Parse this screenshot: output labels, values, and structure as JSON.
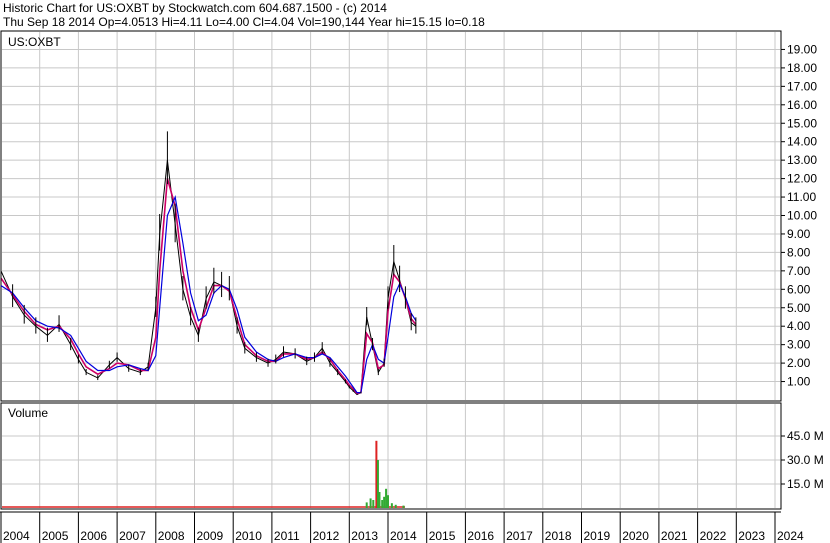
{
  "header": {
    "line1": "Historic Chart for US:OXBT by Stockwatch.com 604.687.1500 - (c) 2014",
    "line2": "Thu Sep 18 2014  Op=4.0513  Hi=4.11  Lo=4.00  Cl=4.04  Vol=190,144  Year hi=15.15  lo=0.18"
  },
  "chart_data": [
    {
      "type": "line",
      "title": "US:OXBT",
      "xlabel": "",
      "ylabel": "",
      "ylim": [
        0,
        20
      ],
      "x_ticks": [
        "2004",
        "2005",
        "2006",
        "2007",
        "2008",
        "2009",
        "2010",
        "2011",
        "2012",
        "2013",
        "2014",
        "2015",
        "2016",
        "2017",
        "2018",
        "2019",
        "2020",
        "2021",
        "2022",
        "2023",
        "2024"
      ],
      "y_ticks": [
        "19.00",
        "18.00",
        "17.00",
        "16.00",
        "15.00",
        "14.00",
        "13.00",
        "12.00",
        "11.00",
        "10.00",
        "9.00",
        "8.00",
        "7.00",
        "6.00",
        "5.00",
        "4.00",
        "3.00",
        "2.00",
        "1.00"
      ],
      "grid": true,
      "x": [
        2004.0,
        2004.3,
        2004.6,
        2004.9,
        2005.2,
        2005.5,
        2005.8,
        2006.0,
        2006.2,
        2006.5,
        2006.8,
        2007.0,
        2007.3,
        2007.6,
        2007.8,
        2008.0,
        2008.1,
        2008.3,
        2008.5,
        2008.7,
        2008.9,
        2009.1,
        2009.3,
        2009.5,
        2009.7,
        2009.9,
        2010.1,
        2010.3,
        2010.6,
        2010.9,
        2011.1,
        2011.3,
        2011.6,
        2011.9,
        2012.1,
        2012.3,
        2012.5,
        2012.7,
        2012.9,
        2013.0,
        2013.1,
        2013.2,
        2013.3,
        2013.45,
        2013.6,
        2013.75,
        2013.9,
        2014.0,
        2014.15,
        2014.3,
        2014.45,
        2014.6,
        2014.72
      ],
      "series": [
        {
          "values": [
            7.0,
            5.6,
            4.6,
            4.0,
            3.5,
            4.1,
            3.0,
            2.2,
            1.5,
            1.2,
            1.9,
            2.3,
            1.7,
            1.5,
            1.8,
            5.0,
            9.0,
            13.0,
            9.5,
            6.0,
            4.5,
            3.5,
            5.5,
            6.4,
            6.2,
            6.0,
            4.0,
            2.8,
            2.3,
            2.0,
            2.2,
            2.6,
            2.5,
            2.1,
            2.3,
            2.8,
            2.0,
            1.5,
            1.0,
            0.7,
            0.5,
            0.3,
            0.4,
            4.5,
            3.0,
            1.5,
            2.0,
            5.5,
            7.5,
            6.5,
            5.5,
            4.2,
            4.0
          ]
        },
        {
          "values": [
            6.6,
            5.7,
            4.8,
            4.1,
            3.8,
            4.0,
            3.3,
            2.5,
            1.8,
            1.4,
            1.7,
            2.0,
            1.9,
            1.6,
            1.6,
            3.4,
            7.0,
            12.0,
            10.5,
            7.0,
            5.0,
            3.8,
            5.0,
            6.2,
            6.2,
            5.9,
            4.4,
            3.0,
            2.4,
            2.1,
            2.1,
            2.5,
            2.5,
            2.2,
            2.3,
            2.6,
            2.2,
            1.6,
            1.1,
            0.8,
            0.6,
            0.35,
            0.4,
            3.6,
            3.1,
            1.7,
            1.9,
            4.8,
            6.8,
            6.4,
            5.5,
            4.4,
            4.1
          ]
        },
        {
          "values": [
            6.2,
            5.8,
            5.0,
            4.3,
            4.0,
            3.9,
            3.5,
            2.8,
            2.1,
            1.6,
            1.6,
            1.8,
            1.9,
            1.7,
            1.6,
            2.4,
            5.0,
            10.0,
            11.0,
            8.5,
            5.8,
            4.3,
            4.6,
            5.8,
            6.2,
            6.0,
            4.9,
            3.4,
            2.6,
            2.2,
            2.1,
            2.3,
            2.5,
            2.3,
            2.3,
            2.5,
            2.3,
            1.8,
            1.3,
            1.0,
            0.7,
            0.4,
            0.4,
            2.2,
            3.0,
            2.2,
            2.0,
            3.4,
            5.6,
            6.3,
            5.6,
            4.7,
            4.3
          ]
        }
      ]
    },
    {
      "type": "bar",
      "title": "Volume",
      "ylim": [
        0,
        50
      ],
      "y_ticks": [
        "45.0 M",
        "30.0 M",
        "15.0 M"
      ],
      "x": [
        2013.45,
        2013.55,
        2013.62,
        2013.7,
        2013.74,
        2013.78,
        2013.85,
        2013.9,
        2013.95,
        2014.0,
        2014.1,
        2014.2,
        2014.4
      ],
      "values": [
        3.5,
        6.0,
        5.0,
        42.0,
        30.0,
        10.0,
        5.0,
        7.0,
        12.0,
        8.0,
        3.0,
        2.0,
        1.5
      ]
    }
  ],
  "colors": {
    "grid": "#c8c8c8",
    "price_bars": "#000000",
    "ma_short": "#cc0066",
    "ma_long": "#0000dd",
    "vol_up": "#33aa33",
    "vol_down": "#dd2222"
  }
}
